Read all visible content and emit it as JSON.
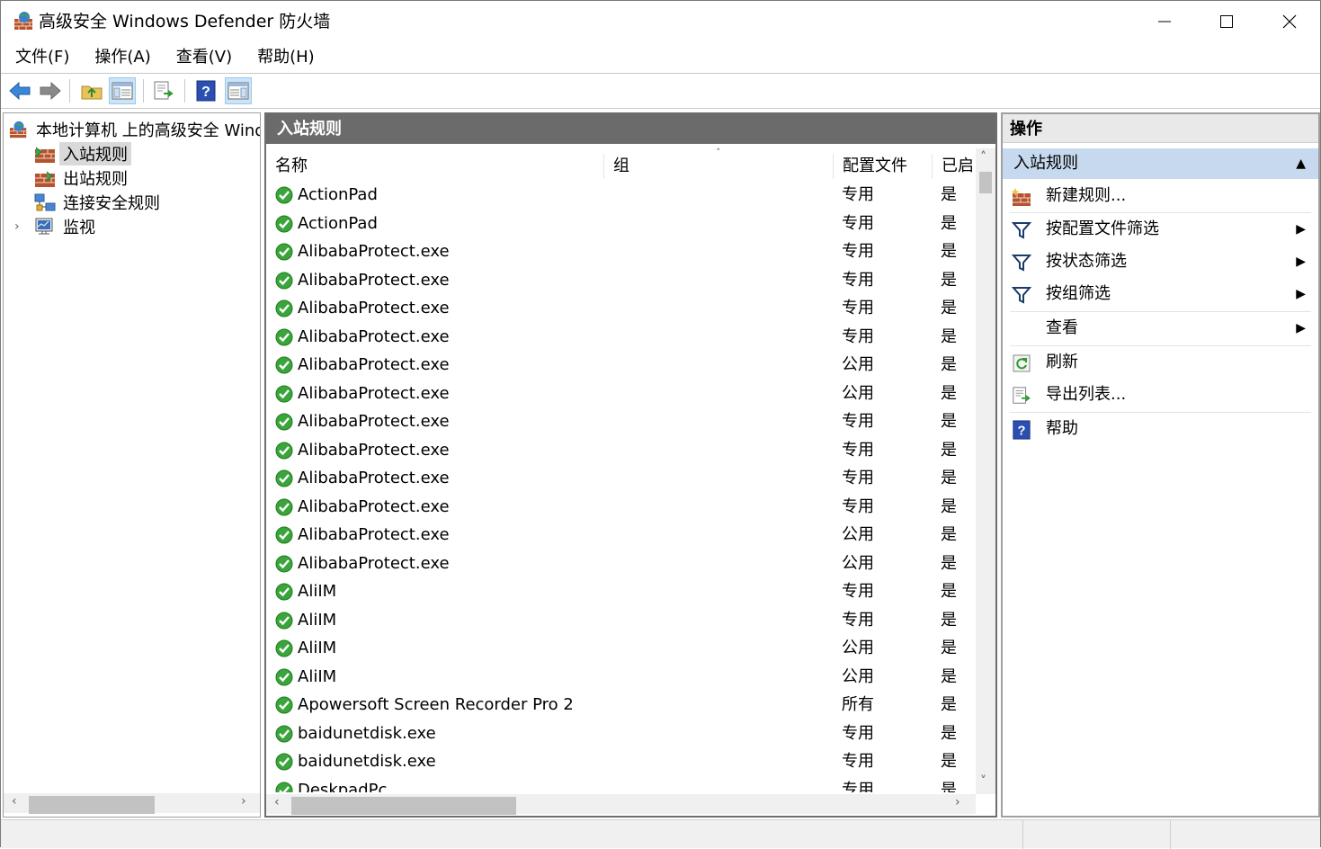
{
  "window": {
    "title": "高级安全 Windows Defender 防火墙"
  },
  "menu": [
    "文件(F)",
    "操作(A)",
    "查看(V)",
    "帮助(H)"
  ],
  "toolbar": [
    "back-arrow-icon",
    "forward-arrow-icon",
    "up-folder-icon",
    "show-hide-tree-icon",
    "export-list-icon",
    "help-icon",
    "show-hide-action-pane-icon"
  ],
  "tree": {
    "root": "本地计算机 上的高级安全 Windows Defender 防火墙",
    "items": [
      {
        "label": "入站规则",
        "icon": "inbound-rules-icon",
        "selected": true
      },
      {
        "label": "出站规则",
        "icon": "outbound-rules-icon",
        "selected": false
      },
      {
        "label": "连接安全规则",
        "icon": "connection-security-icon",
        "selected": false
      },
      {
        "label": "监视",
        "icon": "monitoring-icon",
        "selected": false,
        "expandable": true
      }
    ]
  },
  "main": {
    "header": "入站规则",
    "columns": [
      "名称",
      "组",
      "配置文件",
      "已启"
    ],
    "rows": [
      {
        "name": "ActionPad",
        "profile": "专用",
        "enabled": "是"
      },
      {
        "name": "ActionPad",
        "profile": "专用",
        "enabled": "是"
      },
      {
        "name": "AlibabaProtect.exe",
        "profile": "专用",
        "enabled": "是"
      },
      {
        "name": "AlibabaProtect.exe",
        "profile": "专用",
        "enabled": "是"
      },
      {
        "name": "AlibabaProtect.exe",
        "profile": "专用",
        "enabled": "是"
      },
      {
        "name": "AlibabaProtect.exe",
        "profile": "专用",
        "enabled": "是"
      },
      {
        "name": "AlibabaProtect.exe",
        "profile": "公用",
        "enabled": "是"
      },
      {
        "name": "AlibabaProtect.exe",
        "profile": "公用",
        "enabled": "是"
      },
      {
        "name": "AlibabaProtect.exe",
        "profile": "专用",
        "enabled": "是"
      },
      {
        "name": "AlibabaProtect.exe",
        "profile": "专用",
        "enabled": "是"
      },
      {
        "name": "AlibabaProtect.exe",
        "profile": "专用",
        "enabled": "是"
      },
      {
        "name": "AlibabaProtect.exe",
        "profile": "专用",
        "enabled": "是"
      },
      {
        "name": "AlibabaProtect.exe",
        "profile": "公用",
        "enabled": "是"
      },
      {
        "name": "AlibabaProtect.exe",
        "profile": "公用",
        "enabled": "是"
      },
      {
        "name": "AliIM",
        "profile": "专用",
        "enabled": "是"
      },
      {
        "name": "AliIM",
        "profile": "专用",
        "enabled": "是"
      },
      {
        "name": "AliIM",
        "profile": "公用",
        "enabled": "是"
      },
      {
        "name": "AliIM",
        "profile": "公用",
        "enabled": "是"
      },
      {
        "name": "Apowersoft Screen Recorder Pro 2",
        "profile": "所有",
        "enabled": "是"
      },
      {
        "name": "baidunetdisk.exe",
        "profile": "专用",
        "enabled": "是"
      },
      {
        "name": "baidunetdisk.exe",
        "profile": "专用",
        "enabled": "是"
      },
      {
        "name": "DeskpadPc",
        "profile": "专用",
        "enabled": "是"
      }
    ]
  },
  "actions": {
    "header": "操作",
    "section": "入站规则",
    "items": [
      {
        "label": "新建规则...",
        "icon": "new-rule-icon",
        "submenu": false
      },
      {
        "label": "按配置文件筛选",
        "icon": "filter-icon",
        "submenu": true
      },
      {
        "label": "按状态筛选",
        "icon": "filter-icon",
        "submenu": true
      },
      {
        "label": "按组筛选",
        "icon": "filter-icon",
        "submenu": true
      },
      {
        "label": "查看",
        "icon": "",
        "submenu": true
      },
      {
        "label": "刷新",
        "icon": "refresh-icon",
        "submenu": false
      },
      {
        "label": "导出列表...",
        "icon": "export-list-icon",
        "submenu": false
      },
      {
        "label": "帮助",
        "icon": "help-icon",
        "submenu": false
      }
    ]
  }
}
